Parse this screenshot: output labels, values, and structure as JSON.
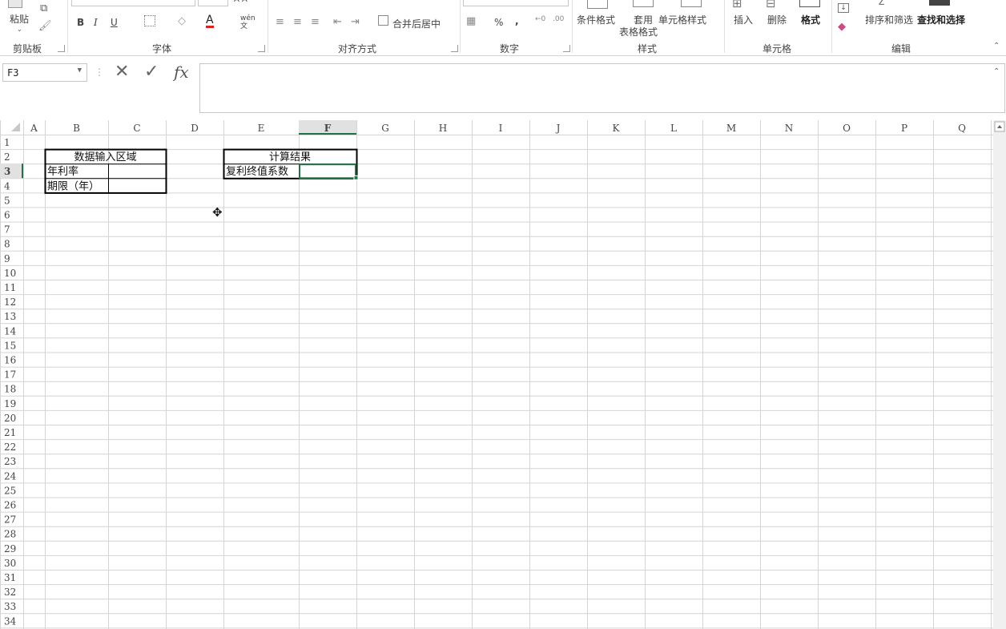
{
  "ribbon": {
    "clipboard": {
      "paste_label": "粘贴",
      "group_label": "剪贴板"
    },
    "font": {
      "bold": "B",
      "italic": "I",
      "underline": "U",
      "font_color_letter": "A",
      "wen": "wén文",
      "group_label": "字体"
    },
    "alignment": {
      "merge_label": "合并后居中",
      "group_label": "对齐方式"
    },
    "number": {
      "percent": "%",
      "comma": ",",
      "group_label": "数字"
    },
    "styles": {
      "conditional_label": "条件格式",
      "table_label_1": "套用",
      "table_label_2": "表格格式",
      "cell_styles_label": "单元格样式",
      "group_label": "样式"
    },
    "cells": {
      "insert_label": "插入",
      "delete_label": "删除",
      "format_label": "格式",
      "group_label": "单元格"
    },
    "editing": {
      "sort_label": "排序和筛选",
      "find_label": "查找和选择",
      "group_label": "编辑"
    }
  },
  "formula_bar": {
    "name_box": "F3",
    "fx_label": "fx",
    "content": ""
  },
  "columns": [
    "A",
    "B",
    "C",
    "D",
    "E",
    "F",
    "G",
    "H",
    "I",
    "J",
    "K",
    "L",
    "M",
    "N",
    "O",
    "P",
    "Q"
  ],
  "active_column": "F",
  "rows": [
    1,
    2,
    3,
    4,
    5,
    6,
    7,
    8,
    9,
    10,
    11,
    12,
    13,
    14,
    15,
    16,
    17,
    18,
    19,
    20,
    21,
    22,
    23,
    24,
    25,
    26,
    27,
    28,
    29,
    30,
    31,
    32,
    33,
    34
  ],
  "active_row": 3,
  "cells": {
    "B2": "数据输入区域",
    "B3": "年利率",
    "B4": "期限（年）",
    "E2": "计算结果",
    "E3": "复利终值系数"
  },
  "colors": {
    "accent": "#217346",
    "grid": "#d4d4d4",
    "header_bg": "#ffffff"
  }
}
